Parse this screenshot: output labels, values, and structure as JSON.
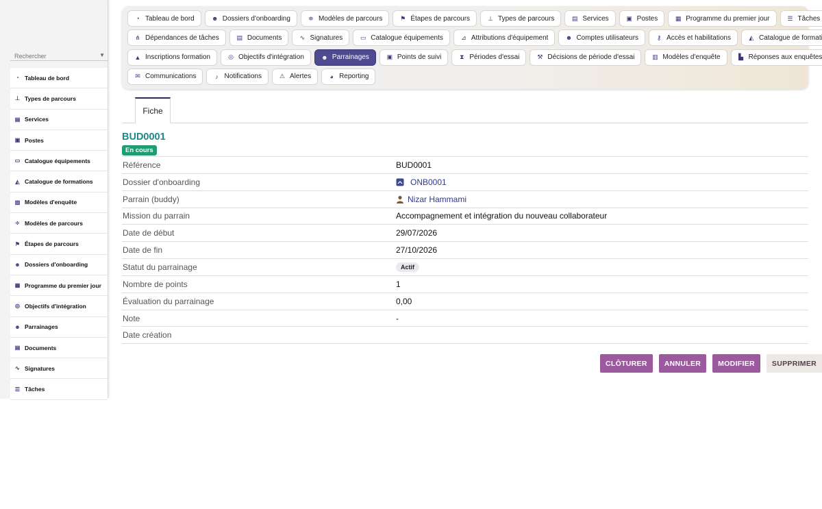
{
  "sidebar": {
    "search_placeholder": "Rechercher",
    "items": [
      {
        "label": "Tableau de bord",
        "icon": "dashboard-icon",
        "glyph": "◔"
      },
      {
        "label": "Types de parcours",
        "icon": "sitemap-icon",
        "glyph": "⊥"
      },
      {
        "label": "Services",
        "icon": "building-icon",
        "glyph": "▤"
      },
      {
        "label": "Postes",
        "icon": "id-badge-icon",
        "glyph": "▣"
      },
      {
        "label": "Catalogue équipements",
        "icon": "laptop-icon",
        "glyph": "▭"
      },
      {
        "label": "Catalogue de formations",
        "icon": "graduation-cap-icon",
        "glyph": "◭"
      },
      {
        "label": "Modèles d'enquête",
        "icon": "clipboard-icon",
        "glyph": "▥"
      },
      {
        "label": "Modèles de parcours",
        "icon": "signs-icon",
        "glyph": "≑"
      },
      {
        "label": "Étapes de parcours",
        "icon": "flag-icon",
        "glyph": "⚑"
      },
      {
        "label": "Dossiers d'onboarding",
        "icon": "user-plus-icon",
        "glyph": "☻"
      },
      {
        "label": "Programme du premier jour",
        "icon": "calendar-icon",
        "glyph": "▦"
      },
      {
        "label": "Objectifs d'intégration",
        "icon": "target-icon",
        "glyph": "◎"
      },
      {
        "label": "Parrainages",
        "icon": "users-icon",
        "glyph": "☻"
      },
      {
        "label": "Documents",
        "icon": "file-icon",
        "glyph": "▤"
      },
      {
        "label": "Signatures",
        "icon": "signature-icon",
        "glyph": "∿"
      },
      {
        "label": "Tâches",
        "icon": "list-icon",
        "glyph": "☰"
      }
    ]
  },
  "tabs": {
    "rows": [
      [
        {
          "label": "Tableau de bord",
          "icon": "dashboard-icon",
          "glyph": "◔"
        },
        {
          "label": "Dossiers d'onboarding",
          "icon": "user-plus-icon",
          "glyph": "☻"
        },
        {
          "label": "Modèles de parcours",
          "icon": "signs-icon",
          "glyph": "≑"
        },
        {
          "label": "Étapes de parcours",
          "icon": "flag-icon",
          "glyph": "⚑"
        },
        {
          "label": "Types de parcours",
          "icon": "sitemap-icon",
          "glyph": "⊥"
        },
        {
          "label": "Services",
          "icon": "building-icon",
          "glyph": "▤"
        },
        {
          "label": "Postes",
          "icon": "id-badge-icon",
          "glyph": "▣"
        },
        {
          "label": "Programme du premier jour",
          "icon": "calendar-icon",
          "glyph": "▦"
        },
        {
          "label": "Tâches",
          "icon": "list-icon",
          "glyph": "☰"
        }
      ],
      [
        {
          "label": "Dépendances de tâches",
          "icon": "project-diagram-icon",
          "glyph": "⋔"
        },
        {
          "label": "Documents",
          "icon": "file-icon",
          "glyph": "▤"
        },
        {
          "label": "Signatures",
          "icon": "signature-icon",
          "glyph": "∿"
        },
        {
          "label": "Catalogue équipements",
          "icon": "laptop-icon",
          "glyph": "▭"
        },
        {
          "label": "Attributions d'équipement",
          "icon": "dolly-icon",
          "glyph": "⊿"
        },
        {
          "label": "Comptes utilisateurs",
          "icon": "user-cog-icon",
          "glyph": "☻"
        },
        {
          "label": "Accès et habilitations",
          "icon": "key-icon",
          "glyph": "⚷"
        },
        {
          "label": "Catalogue de formations",
          "icon": "graduation-cap-icon",
          "glyph": "◭"
        }
      ],
      [
        {
          "label": "Inscriptions formation",
          "icon": "user-graduate-icon",
          "glyph": "▲"
        },
        {
          "label": "Objectifs d'intégration",
          "icon": "target-icon",
          "glyph": "◎"
        },
        {
          "label": "Parrainages",
          "icon": "users-icon",
          "glyph": "☻",
          "active": true
        },
        {
          "label": "Points de suivi",
          "icon": "clipboard-check-icon",
          "glyph": "▣"
        },
        {
          "label": "Périodes d'essai",
          "icon": "hourglass-icon",
          "glyph": "⧗"
        },
        {
          "label": "Décisions de période d'essai",
          "icon": "gavel-icon",
          "glyph": "⚒"
        },
        {
          "label": "Modèles d'enquête",
          "icon": "clipboard-icon",
          "glyph": "▥"
        },
        {
          "label": "Réponses aux enquêtes",
          "icon": "chart-bar-icon",
          "glyph": "▙"
        }
      ],
      [
        {
          "label": "Communications",
          "icon": "envelope-icon",
          "glyph": "✉"
        },
        {
          "label": "Notifications",
          "icon": "bell-icon",
          "glyph": "♪"
        },
        {
          "label": "Alertes",
          "icon": "warning-icon",
          "glyph": "⚠"
        },
        {
          "label": "Reporting",
          "icon": "pie-chart-icon",
          "glyph": "◕"
        }
      ]
    ]
  },
  "view": {
    "tab_label": "Fiche"
  },
  "record": {
    "title": "BUD0001",
    "status": "En cours",
    "fields": {
      "reference_label": "Référence",
      "reference_value": "BUD0001",
      "dossier_label": "Dossier d'onboarding",
      "dossier_value": "ONB0001",
      "parrain_label": "Parrain (buddy)",
      "parrain_value": "Nizar Hammami",
      "mission_label": "Mission du parrain",
      "mission_value": "Accompagnement et intégration du nouveau collaborateur",
      "debut_label": "Date de début",
      "debut_value": "29/07/2026",
      "fin_label": "Date de fin",
      "fin_value": "27/10/2026",
      "statut_label": "Statut du parrainage",
      "statut_value": "Actif",
      "points_label": "Nombre de points",
      "points_value": "1",
      "evaluation_label": "Évaluation du parrainage",
      "evaluation_value": "0,00",
      "note_label": "Note",
      "note_value": "-",
      "creation_label": "Date création",
      "creation_value": ""
    }
  },
  "actions": {
    "cloturer": "CLÔTURER",
    "annuler": "ANNULER",
    "modifier": "MODIFIER",
    "supprimer": "SUPPRIMER"
  },
  "colors": {
    "accent": "#4d4a8f",
    "title": "#1b8a8a",
    "status_badge": "#1f9c74",
    "action_button": "#9c5a9e"
  }
}
